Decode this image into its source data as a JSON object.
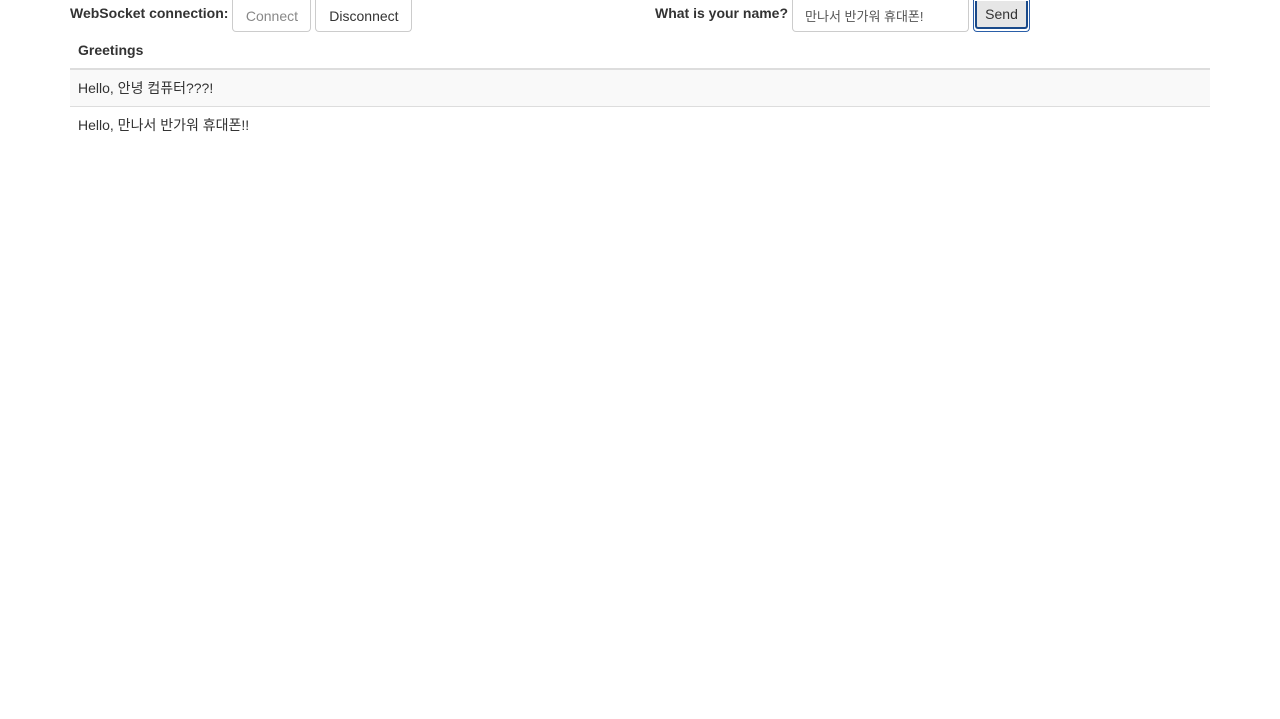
{
  "connection": {
    "label": "WebSocket connection:",
    "connect_label": "Connect",
    "disconnect_label": "Disconnect"
  },
  "name_form": {
    "label": "What is your name?",
    "input_value": "만나서 반가워 휴대폰!",
    "send_label": "Send"
  },
  "greetings": {
    "header": "Greetings",
    "rows": [
      "Hello, 안녕 컴퓨터???!",
      "Hello, 만나서 반가워 휴대폰!!"
    ]
  }
}
